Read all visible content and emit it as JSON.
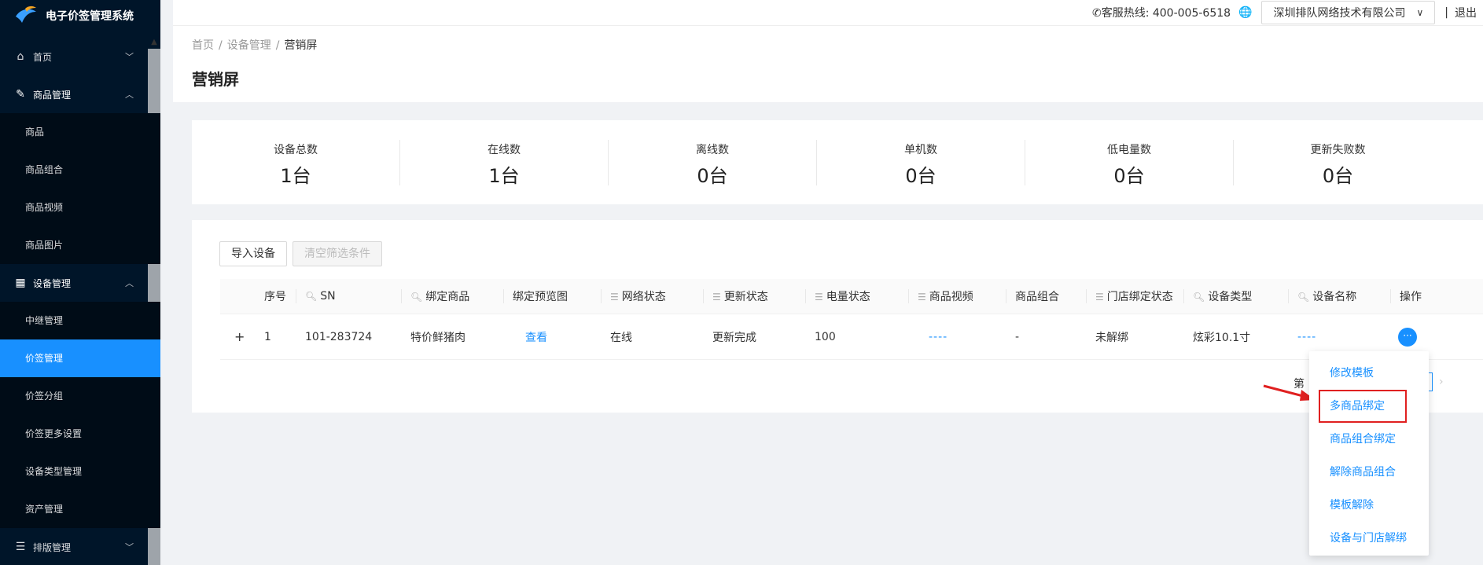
{
  "app": {
    "title": "电子价签管理系统"
  },
  "sidebar": {
    "groups": [
      {
        "label": "首页",
        "icon": "home-icon"
      },
      {
        "label": "商品管理",
        "icon": "edit-icon"
      },
      {
        "label": "设备管理",
        "icon": "table-icon"
      },
      {
        "label": "排版管理",
        "icon": "list-icon"
      }
    ],
    "goods_items": [
      "商品",
      "商品组合",
      "商品视频",
      "商品图片"
    ],
    "device_items": [
      "中继管理",
      "价签管理",
      "价签分组",
      "价签更多设置",
      "设备类型管理",
      "资产管理"
    ]
  },
  "header": {
    "hotline": "客服热线: 400-005-6518",
    "company": "深圳排队网络技术有限公司",
    "logout": "退出"
  },
  "breadcrumb": {
    "home": "首页",
    "device": "设备管理",
    "current": "营销屏"
  },
  "page_title": "营销屏",
  "stats": [
    {
      "label": "设备总数",
      "value": "1台"
    },
    {
      "label": "在线数",
      "value": "1台"
    },
    {
      "label": "离线数",
      "value": "0台"
    },
    {
      "label": "单机数",
      "value": "0台"
    },
    {
      "label": "低电量数",
      "value": "0台"
    },
    {
      "label": "更新失败数",
      "value": "0台"
    }
  ],
  "toolbar": {
    "import_label": "导入设备",
    "clear_label": "清空筛选条件"
  },
  "table": {
    "headers": [
      "序号",
      "SN",
      "绑定商品",
      "绑定预览图",
      "网络状态",
      "更新状态",
      "电量状态",
      "商品视频",
      "商品组合",
      "门店绑定状态",
      "设备类型",
      "设备名称",
      "操作"
    ],
    "row": {
      "expand": "+",
      "index": "1",
      "sn": "101-283724",
      "goods": "特价鲜猪肉",
      "preview": "查看",
      "network": "在线",
      "update": "更新完成",
      "battery": "100",
      "video": "----",
      "combo": "-",
      "store": "未解绑",
      "type": "炫彩10.1寸",
      "name": "----",
      "action": "···"
    }
  },
  "pager": {
    "prefix": "第"
  },
  "dropdown": [
    "修改模板",
    "多商品绑定",
    "商品组合绑定",
    "解除商品组合",
    "模板解除",
    "设备与门店解绑"
  ]
}
